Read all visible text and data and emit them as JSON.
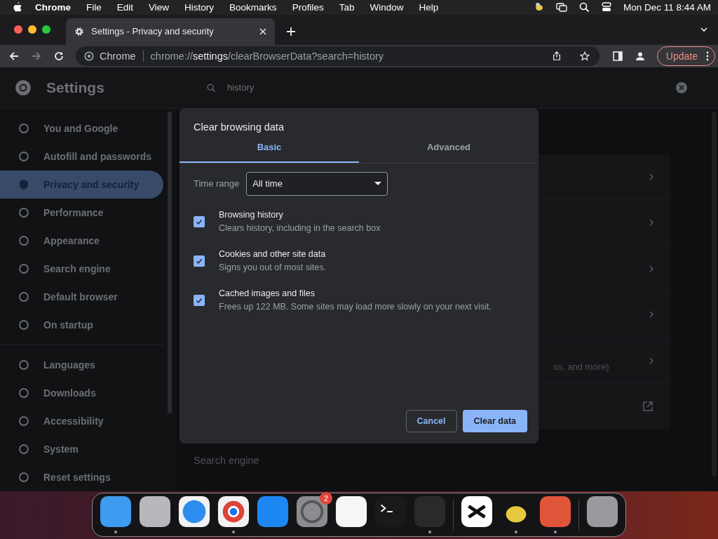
{
  "menu_bar": {
    "app": "Chrome",
    "items": [
      "File",
      "Edit",
      "View",
      "History",
      "Bookmarks",
      "Profiles",
      "Tab",
      "Window",
      "Help"
    ],
    "clock": "Mon Dec 11  8:44 AM"
  },
  "browser": {
    "tab": {
      "title": "Settings - Privacy and security",
      "selected": true
    },
    "site_label": "Chrome",
    "url_prefix": "chrome://",
    "url_host": "settings",
    "url_path": "/clearBrowserData?search=history",
    "update_button": "Update"
  },
  "settings": {
    "title": "Settings",
    "search": {
      "value": "history"
    },
    "sidebar": {
      "items": [
        {
          "label": "You and Google",
          "selected": false
        },
        {
          "label": "Autofill and passwords",
          "selected": false
        },
        {
          "label": "Privacy and security",
          "selected": true
        },
        {
          "label": "Performance",
          "selected": false
        },
        {
          "label": "Appearance",
          "selected": false
        },
        {
          "label": "Search engine",
          "selected": false
        },
        {
          "label": "Default browser",
          "selected": false
        },
        {
          "label": "On startup",
          "selected": false
        }
      ],
      "more_items": [
        {
          "label": "Languages",
          "selected": false
        },
        {
          "label": "Downloads",
          "selected": false
        },
        {
          "label": "Accessibility",
          "selected": false
        },
        {
          "label": "System",
          "selected": false
        },
        {
          "label": "Reset settings",
          "selected": false
        }
      ]
    },
    "background_text": "ss, and more)",
    "section_title": "Search engine"
  },
  "dialog": {
    "title": "Clear browsing data",
    "tabs": [
      {
        "label": "Basic",
        "selected": true
      },
      {
        "label": "Advanced",
        "selected": false
      }
    ],
    "time_range": {
      "label": "Time range",
      "value": "All time"
    },
    "options": [
      {
        "title": "Browsing history",
        "description": "Clears history, including in the search box",
        "checked": true
      },
      {
        "title": "Cookies and other site data",
        "description": "Signs you out of most sites.",
        "checked": true
      },
      {
        "title": "Cached images and files",
        "description": "Frees up 122 MB. Some sites may load more slowly on your next visit.",
        "checked": true
      }
    ],
    "buttons": {
      "cancel": "Cancel",
      "confirm": "Clear data"
    }
  },
  "dock": [
    {
      "running": true
    },
    {
      "running": false
    },
    {
      "running": false
    },
    {
      "running": true
    },
    {
      "running": false
    },
    {
      "running": false,
      "badge": "2"
    },
    {
      "running": false
    },
    {
      "running": false
    },
    {
      "running": true
    },
    {
      "running": false
    },
    {
      "running": true
    },
    {
      "running": true
    },
    {
      "running": false
    }
  ]
}
